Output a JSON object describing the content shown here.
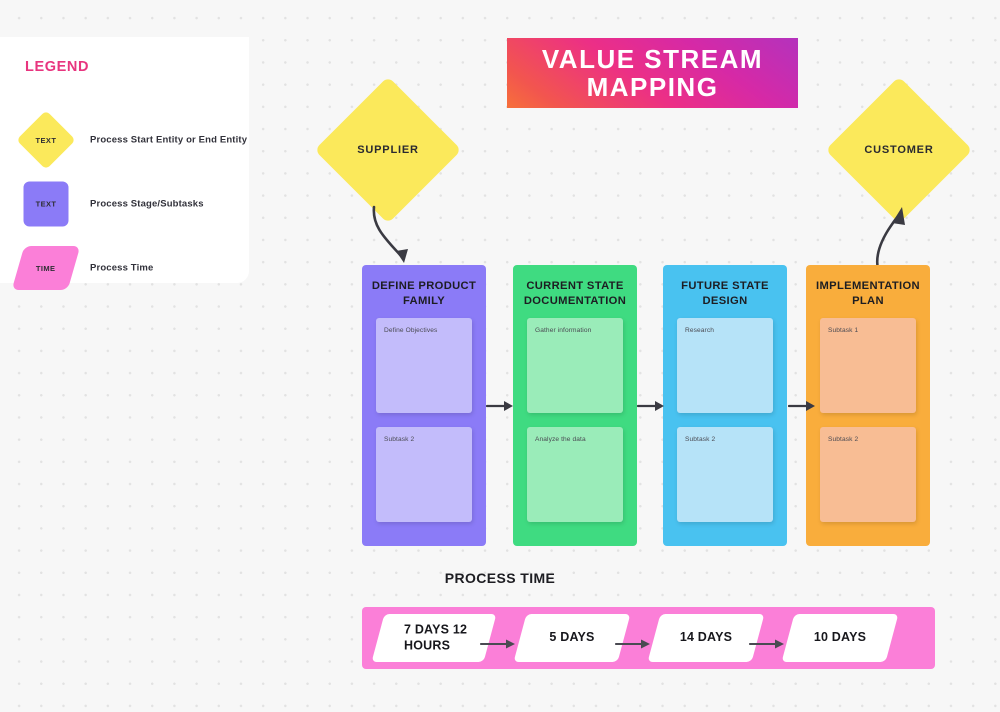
{
  "title": {
    "line_1": "VALUE STREAM",
    "line_2": "MAPPING",
    "gradient_from": "#f7703a",
    "gradient_to": "#b432bd"
  },
  "legend": {
    "heading": "LEGEND",
    "heading_color": "#e8357f",
    "items": [
      {
        "shape": "diamond",
        "shape_label": "TEXT",
        "description": "Process Start Entity or End Entity",
        "color": "#fbe95b"
      },
      {
        "shape": "square",
        "shape_label": "TEXT",
        "description": "Process Stage/Subtasks",
        "color": "#8b7bf7"
      },
      {
        "shape": "parallelogram",
        "shape_label": "TIME",
        "description": "Process Time",
        "color": "#fb7fd8"
      }
    ]
  },
  "entities": {
    "start": {
      "label": "SUPPLIER",
      "color": "#fbe95b"
    },
    "end": {
      "label": "CUSTOMER",
      "color": "#fbe95b"
    }
  },
  "columns": [
    {
      "title": "DEFINE PRODUCT FAMILY",
      "color": "#8b7bf7",
      "card_color": "#c3bcfb",
      "subtasks": [
        "Define Objectives",
        "Subtask 2"
      ]
    },
    {
      "title": "CURRENT STATE DOCUMENTATION",
      "color": "#3fdb81",
      "card_color": "#9aecb9",
      "subtasks": [
        "Gather information",
        "Analyze the data"
      ]
    },
    {
      "title": "FUTURE STATE DESIGN",
      "color": "#49c2f0",
      "card_color": "#b6e3f8",
      "subtasks": [
        "Research",
        "Subtask 2"
      ]
    },
    {
      "title": "IMPLEMENTATION PLAN",
      "color": "#f9ad3c",
      "card_color": "#f8bd94",
      "subtasks": [
        "Subtask 1",
        "Subtask 2"
      ]
    }
  ],
  "process_time": {
    "heading": "PROCESS TIME",
    "band_color": "#fb7fd8",
    "values": [
      "7 DAYS 12 HOURS",
      "5 DAYS",
      "14 DAYS",
      "10 DAYS"
    ]
  }
}
